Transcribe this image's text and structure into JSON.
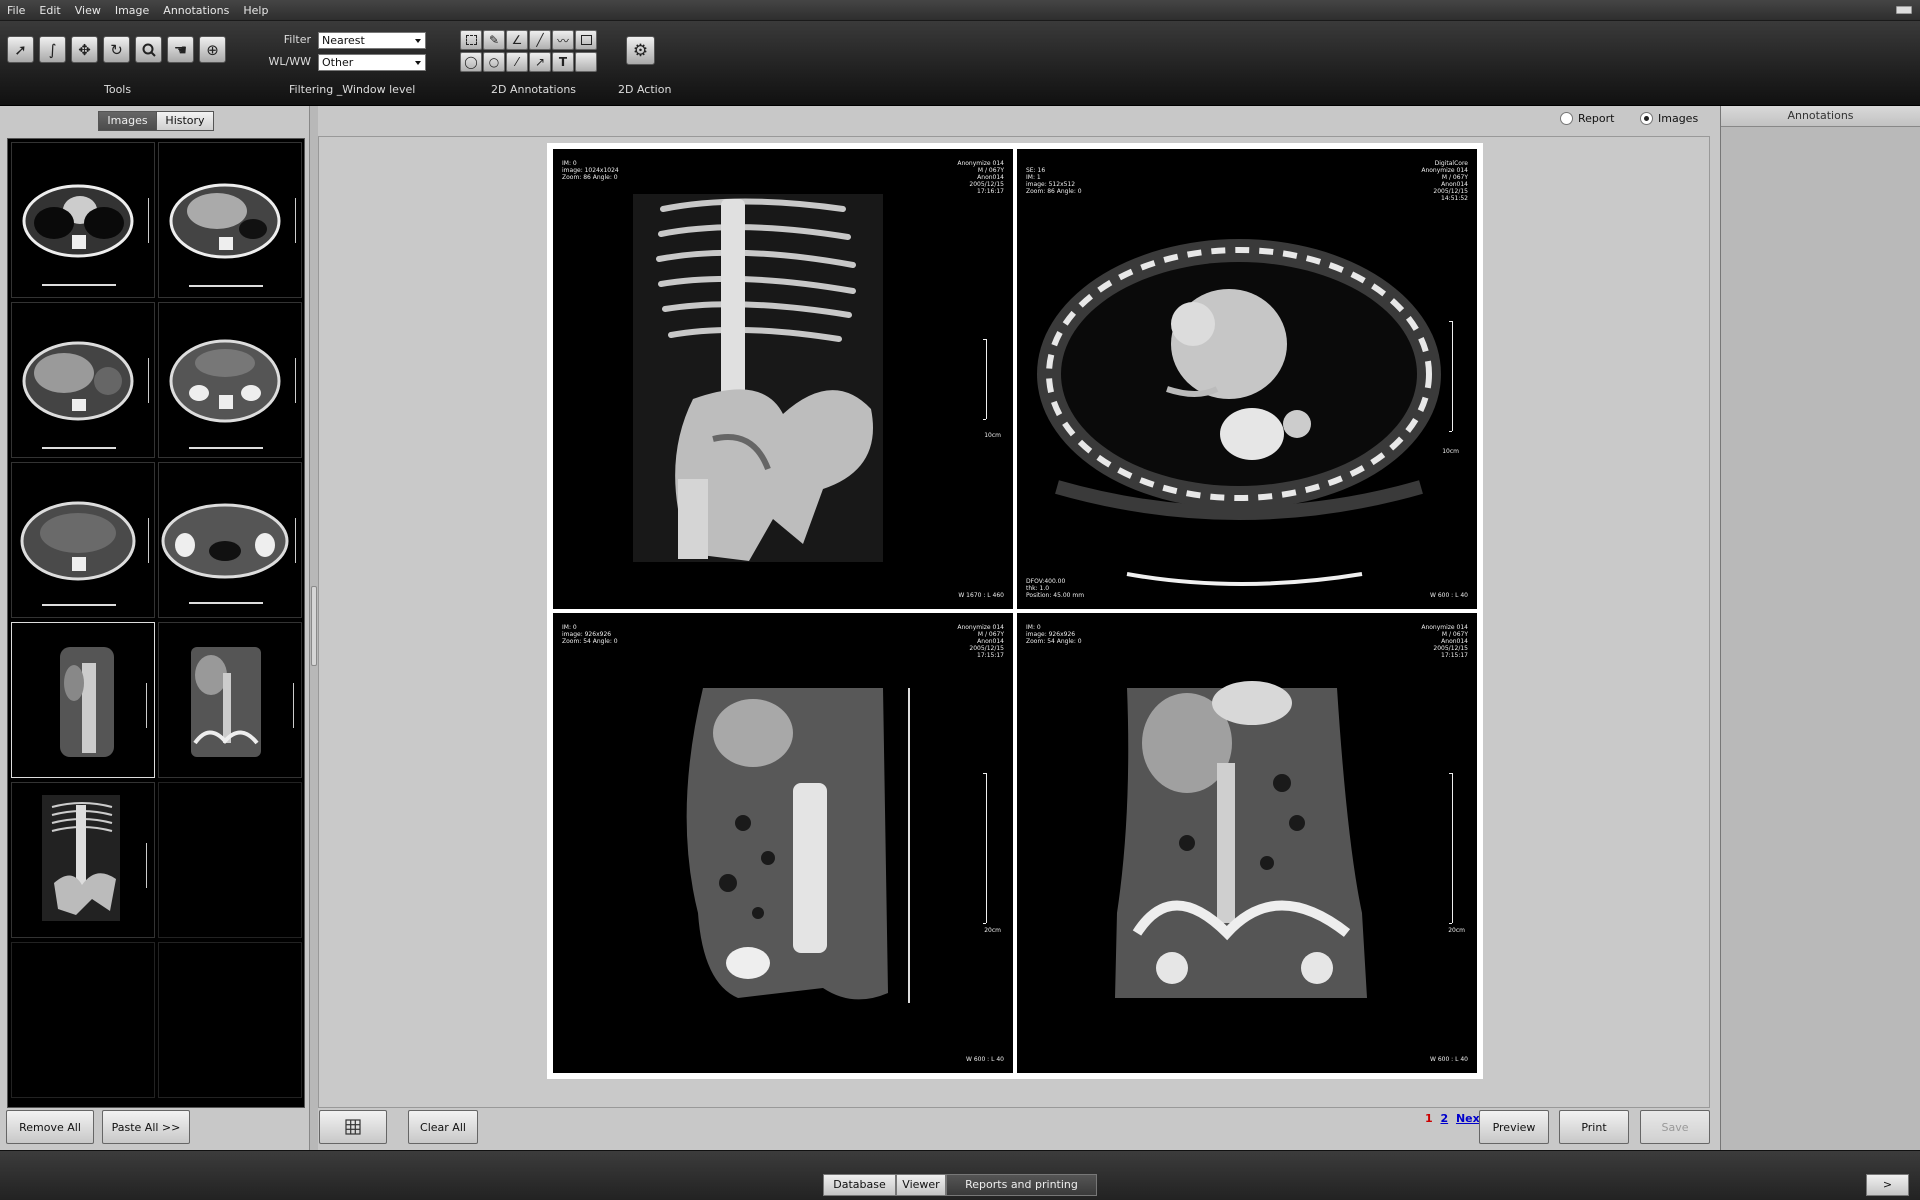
{
  "menu": {
    "items": [
      "File",
      "Edit",
      "View",
      "Image",
      "Annotations",
      "Help"
    ]
  },
  "toolbar": {
    "groups": {
      "tools": "Tools",
      "filtering": "Filtering _Window level",
      "annotations": "2D Annotations",
      "action": "2D Action"
    },
    "filter_label": "Filter",
    "filter_value": "Nearest",
    "wlww_label": "WL/WW",
    "wlww_value": "Other"
  },
  "left": {
    "tab_images": "Images",
    "tab_history": "History",
    "remove_all": "Remove All",
    "paste_all": "Paste All >>"
  },
  "center": {
    "radio_report": "Report",
    "radio_images": "Images",
    "clear_all": "Clear All",
    "preview": "Preview",
    "print": "Print",
    "save": "Save",
    "pager": {
      "current": "1",
      "next_page": "2",
      "next": "Next"
    }
  },
  "viewports": [
    {
      "tl": "IM: 0\nimage: 1024x1024\nZoom: 86 Angle: 0",
      "tr": "Anonymize 014\nM / 067Y\nAnon014\n2005/12/15\n17:16:17",
      "scale": "10cm",
      "br": "W 1670 : L 460",
      "bl": ""
    },
    {
      "tl": "SE: 16\nIM: 1\nimage: 512x512\nZoom: 86 Angle: 0",
      "tr": "DigitalCore\nAnonymize 014\nM / 067Y\nAnon014\n2005/12/15\n14:51:52",
      "scale": "10cm",
      "br": "W 600 : L 40",
      "bl": "DFOV:400.00\nthk: 1.0\nPosition: 45.00 mm"
    },
    {
      "tl": "IM: 0\nimage: 926x926\nZoom: 54 Angle: 0",
      "tr": "Anonymize 014\nM / 067Y\nAnon014\n2005/12/15\n17:15:17",
      "scale": "20cm",
      "br": "W 600 : L 40",
      "bl": ""
    },
    {
      "tl": "IM: 0\nimage: 926x926\nZoom: 54 Angle: 0",
      "tr": "Anonymize 014\nM / 067Y\nAnon014\n2005/12/15\n17:15:17",
      "scale": "20cm",
      "br": "W 600 : L 40",
      "bl": ""
    }
  ],
  "right": {
    "header": "Annotations"
  },
  "bottom_tabs": {
    "database": "Database",
    "viewer": "Viewer",
    "reports": "Reports and printing",
    "collapse": ">"
  },
  "colors": {
    "current_page": "#cc0000",
    "link": "#0000cc"
  }
}
